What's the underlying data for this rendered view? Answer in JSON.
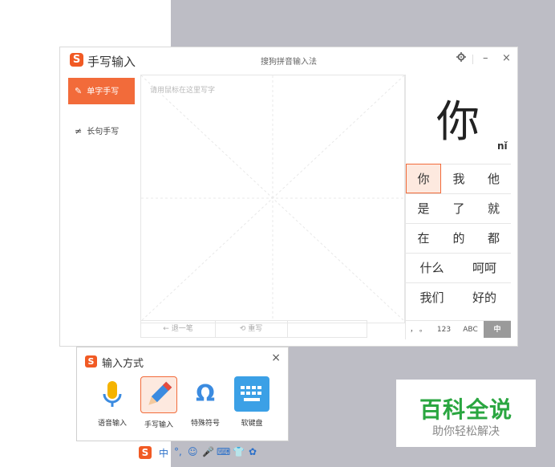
{
  "window": {
    "title": "手写输入",
    "subtitle": "搜狗拼音输入法",
    "settings_icon": "gear-icon",
    "minimize_label": "–",
    "close_label": "×"
  },
  "sidebar": {
    "items": [
      {
        "label": "单字手写",
        "icon": "pen-square-icon",
        "active": true
      },
      {
        "label": "长句手写",
        "icon": "pen-lines-icon",
        "active": false
      }
    ]
  },
  "canvas": {
    "placeholder": "请用鼠标在这里写字",
    "undo_label": "← 退一笔",
    "rewrite_label": "⟲ 重写"
  },
  "candidates": {
    "preview_char": "你",
    "preview_pinyin": "nǐ",
    "rows": [
      [
        "你",
        "我",
        "他"
      ],
      [
        "是",
        "了",
        "就"
      ],
      [
        "在",
        "的",
        "都"
      ],
      [
        "什么",
        "呵呵"
      ],
      [
        "我们",
        "好的"
      ]
    ],
    "modes": [
      "， 。",
      "123",
      "ABC",
      "中"
    ]
  },
  "input_panel": {
    "title": "输入方式",
    "close_label": "×",
    "tools": [
      {
        "label": "语音输入",
        "icon": "microphone-icon"
      },
      {
        "label": "手写输入",
        "icon": "pen-icon",
        "selected": true
      },
      {
        "label": "特殊符号",
        "icon": "omega-icon"
      },
      {
        "label": "软键盘",
        "icon": "keyboard-icon"
      }
    ]
  },
  "statusbar": {
    "logo": "S",
    "items": [
      "中",
      "°,",
      "☺",
      "🎤",
      "⌨",
      "👕",
      "✿"
    ]
  },
  "brand": {
    "title": "百科全说",
    "subtitle": "助你轻松解决"
  },
  "colors": {
    "accent": "#f26b3a",
    "logo": "#f15a24",
    "brand_green": "#2aa640",
    "keyboard_blue": "#3ba0e6"
  }
}
